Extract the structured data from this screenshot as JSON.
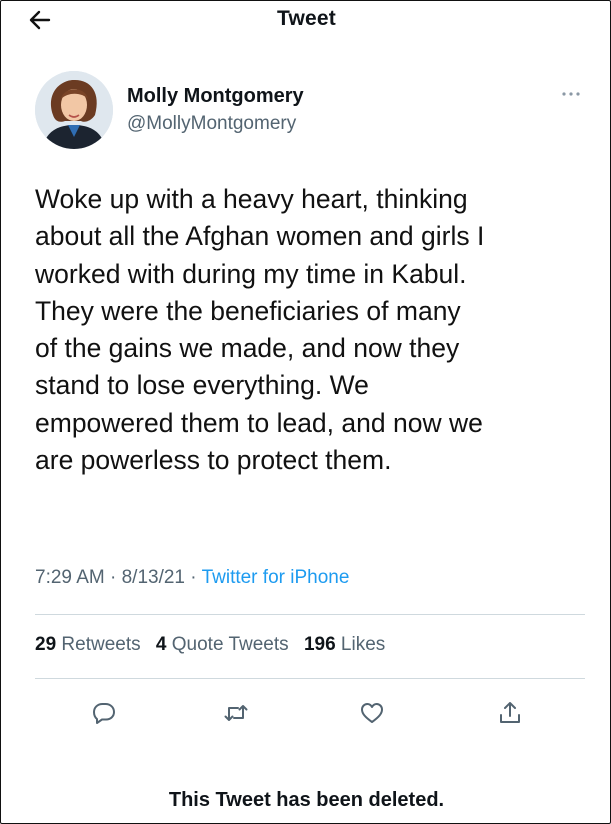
{
  "header": {
    "title": "Tweet",
    "back_icon": "back-arrow-icon"
  },
  "author": {
    "name": "Molly Montgomery",
    "handle": "@MollyMontgomery",
    "more_icon": "more-dots-icon"
  },
  "tweet": {
    "text": "Woke up with a heavy heart, thinking\nabout all the Afghan women and girls I\nworked with during my time in Kabul.\nThey were the beneficiaries of many\nof the gains we made, and now they\nstand to lose everything. We\nempowered them to lead, and now we\nare powerless to protect them.",
    "time": "7:29 AM",
    "date": "8/13/21",
    "separator": "·",
    "source": "Twitter for iPhone"
  },
  "stats": {
    "retweets_count": "29",
    "retweets_label": "Retweets",
    "quotes_count": "4",
    "quotes_label": "Quote Tweets",
    "likes_count": "196",
    "likes_label": "Likes"
  },
  "actions": [
    "reply-icon",
    "retweet-icon",
    "like-icon",
    "share-icon"
  ],
  "notice": "This Tweet has been deleted.",
  "colors": {
    "accent": "#1d9bf0",
    "secondary_text": "#536471",
    "divider": "#cfd9de"
  }
}
